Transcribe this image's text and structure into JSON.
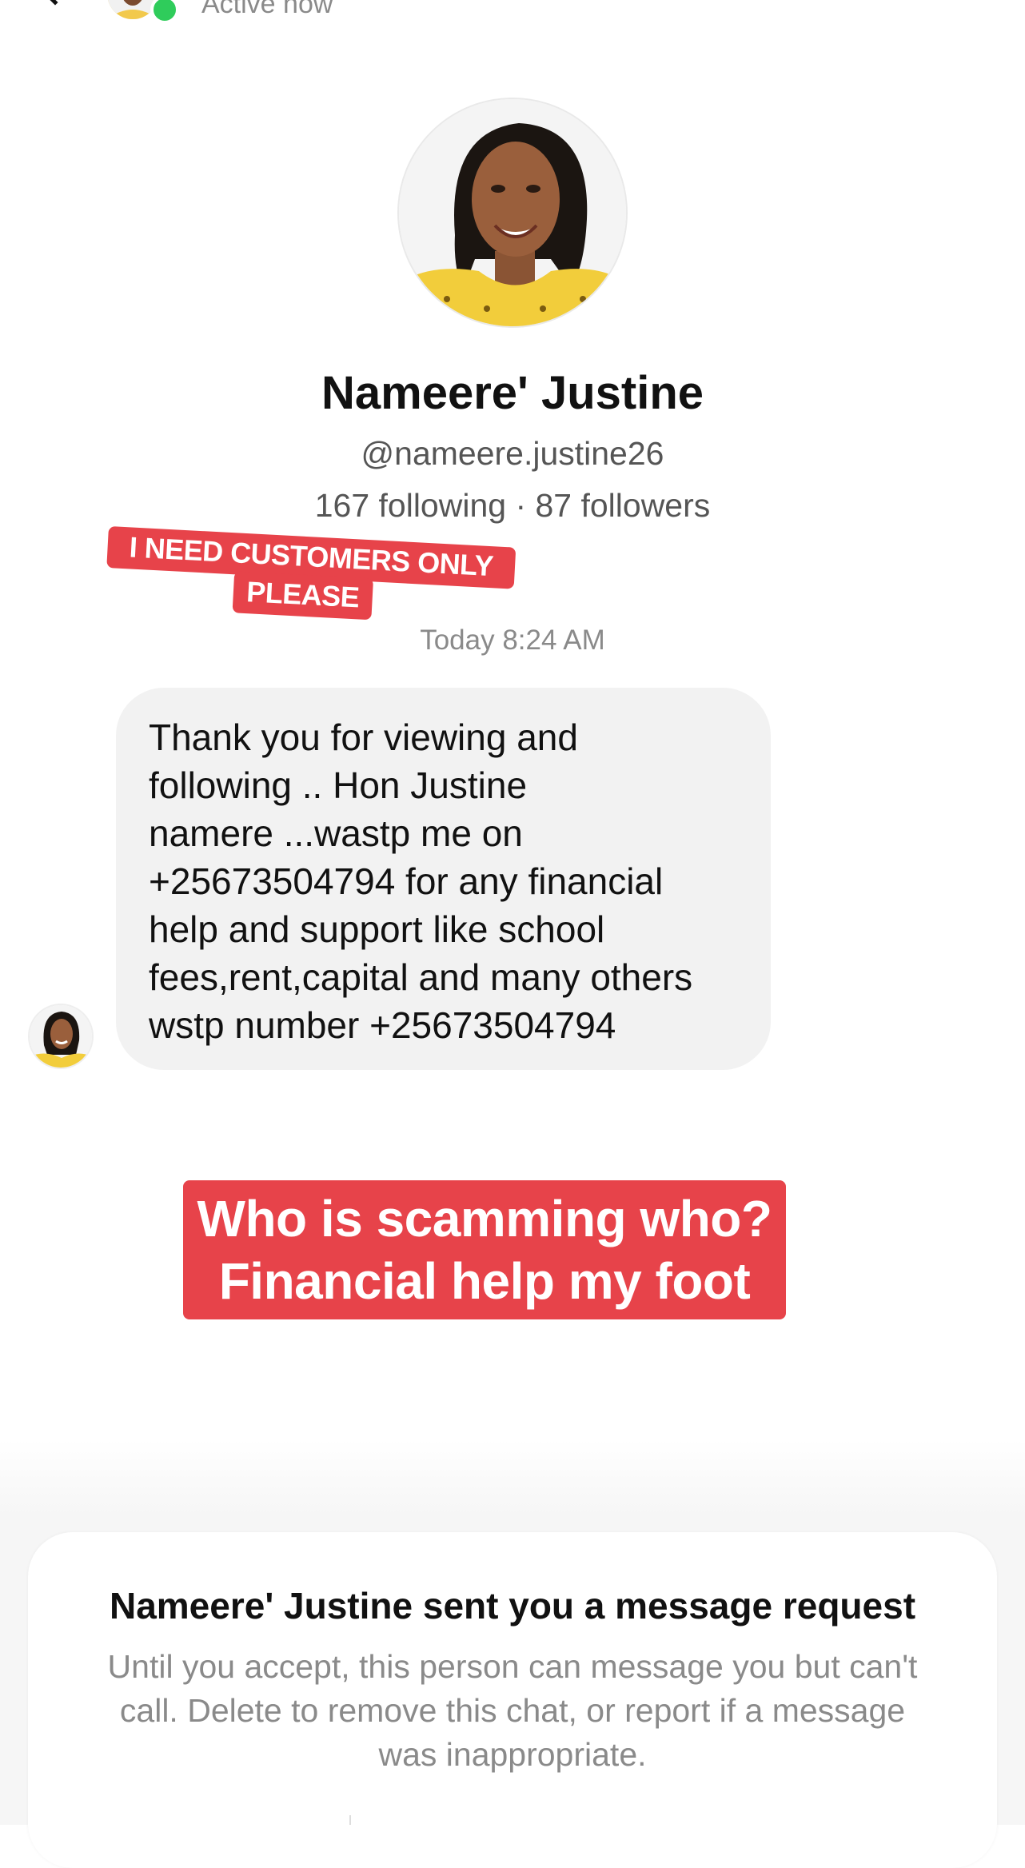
{
  "header": {
    "status_text": "Active now"
  },
  "profile": {
    "display_name": "Nameere' Justine",
    "username": "@nameere.justine26",
    "stats": "167 following · 87 followers"
  },
  "sticker": {
    "line1": "I NEED CUSTOMERS ONLY",
    "line2": "PLEASE"
  },
  "chat": {
    "timestamp": "Today 8:24 AM",
    "message": "Thank you for viewing and\nfollowing .. Hon Justine\nnamere ...wastp me on\n+25673504794 for any financial\nhelp and support like school\nfees,rent,capital and many others\nwstp number +25673504794"
  },
  "caption": {
    "line1": "Who is scamming who?",
    "line2": "Financial help my foot"
  },
  "request": {
    "title": "Nameere' Justine sent you a message request",
    "body": "Until you accept, this person can message you but can't call. Delete to remove this chat, or report if a message was inappropriate."
  },
  "colors": {
    "accent_red": "#e7434a",
    "online_green": "#2fcc5b",
    "bubble_gray": "#f2f2f2"
  },
  "icons": [
    "back-chevron-icon",
    "online-dot-icon"
  ]
}
